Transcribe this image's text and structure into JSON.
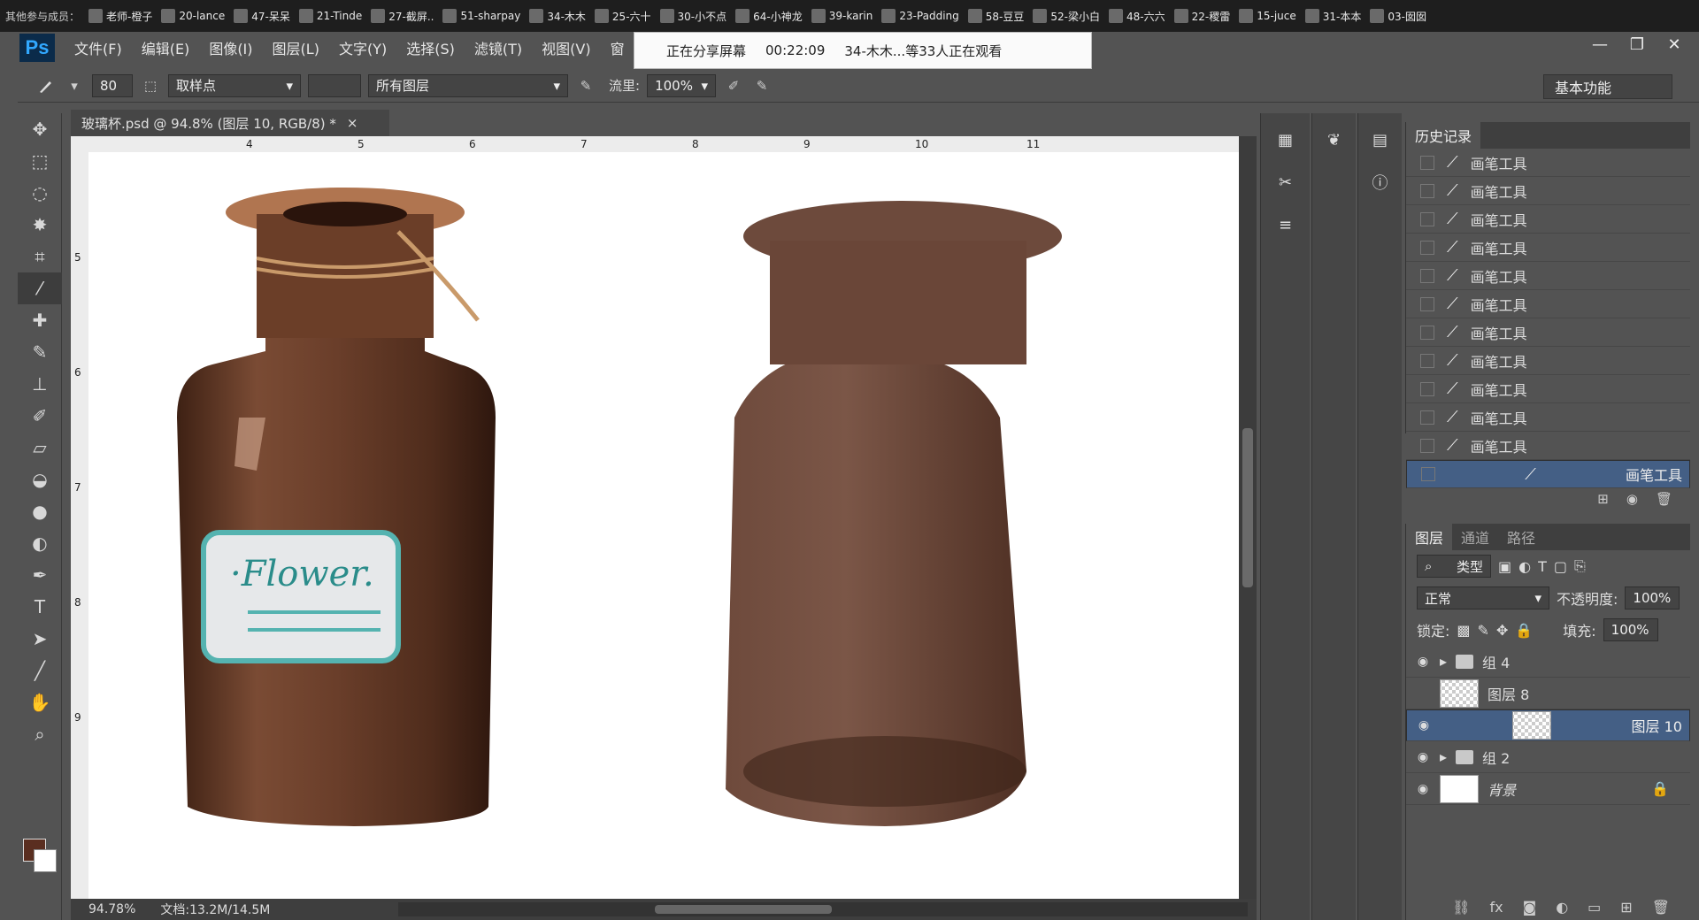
{
  "participants": {
    "lead": "其他参与成员：",
    "names": [
      "老师-橙子",
      "20-lance",
      "47-呆呆",
      "21-Tinde",
      "27-截屏..",
      "51-sharpay",
      "34-木木",
      "25-六十",
      "30-小不点",
      "64-小神龙",
      "39-karin",
      "23-Padding",
      "58-豆豆",
      "52-梁小白",
      "48-六六",
      "22-稷雷",
      "15-juce",
      "31-本本",
      "03-囡囡"
    ]
  },
  "app": {
    "logo": "Ps"
  },
  "menu": [
    "文件(F)",
    "编辑(E)",
    "图像(I)",
    "图层(L)",
    "文字(Y)",
    "选择(S)",
    "滤镜(T)",
    "视图(V)",
    "窗"
  ],
  "share": {
    "status": "正在分享屏幕",
    "time": "00:22:09",
    "viewers": "34-木木...等33人正在观看"
  },
  "window": {
    "min": "—",
    "restore": "❐",
    "close": "✕"
  },
  "options": {
    "brush_size": "80",
    "sample_mode": "取样点",
    "sample_layers": "所有图层",
    "flow_label": "流里:",
    "flow_value": "100%",
    "workspace": "基本功能"
  },
  "document": {
    "tab_title": "玻璃杯.psd @ 94.8% (图层 10, RGB/8) *",
    "close": "×",
    "ruler_h": [
      "4",
      "5",
      "6",
      "7",
      "8",
      "9",
      "10",
      "11"
    ],
    "ruler_v": [
      "5",
      "6",
      "7",
      "8",
      "9"
    ],
    "label_text": "·Flower.",
    "zoom": "94.78%",
    "doc_size": "文档:13.2M/14.5M"
  },
  "history": {
    "tabs": [
      "历史记录"
    ],
    "items": [
      "画笔工具",
      "画笔工具",
      "画笔工具",
      "画笔工具",
      "画笔工具",
      "画笔工具",
      "画笔工具",
      "画笔工具",
      "画笔工具",
      "画笔工具",
      "画笔工具",
      "画笔工具"
    ],
    "selected_index": 11
  },
  "layers_panel": {
    "tabs": [
      "图层",
      "通道",
      "路径"
    ],
    "filter": "类型",
    "blend_mode": "正常",
    "opacity_label": "不透明度:",
    "opacity": "100%",
    "lock_label": "锁定:",
    "fill_label": "填充:",
    "fill": "100%",
    "layers": [
      {
        "name": "组 4",
        "kind": "group",
        "visible": true
      },
      {
        "name": "图层 8",
        "kind": "layer",
        "visible": false
      },
      {
        "name": "图层 10",
        "kind": "layer",
        "visible": true,
        "selected": true
      },
      {
        "name": "组 2",
        "kind": "group",
        "visible": true
      },
      {
        "name": "背景",
        "kind": "background",
        "visible": true
      }
    ]
  },
  "colors": {
    "foreground": "#5a2e20",
    "background": "#ffffff",
    "accent": "#445f85"
  }
}
